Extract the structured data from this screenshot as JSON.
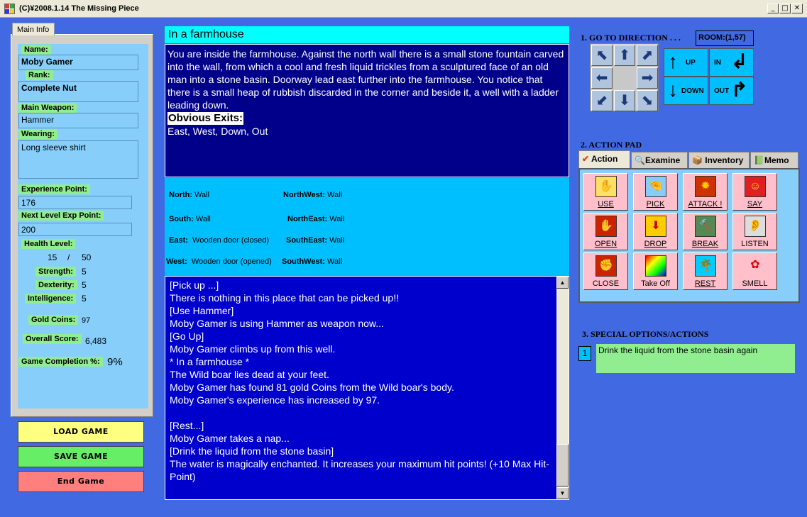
{
  "window": {
    "title": "(C)¥2008.1.14 The Missing Piece",
    "min": "_",
    "max": "□",
    "close": "✕"
  },
  "left": {
    "tab_label": "Main Info",
    "name_label": "Name:",
    "name": "Moby Gamer",
    "rank_label": "Rank:",
    "rank": "Complete Nut",
    "weapon_label": "Main Weapon:",
    "weapon": "Hammer",
    "wearing_label": "Wearing:",
    "wearing": "Long sleeve shirt",
    "exp_label": "Experience Point:",
    "exp": "176",
    "next_label": "Next Level Exp Point:",
    "next": "200",
    "health_label": "Health Level:",
    "health_cur": "15",
    "health_sep": "/",
    "health_max": "50",
    "strength_label": "Strength:",
    "strength": "5",
    "dexterity_label": "Dexterity:",
    "dexterity": "5",
    "intelligence_label": "Intelligence:",
    "intelligence": "5",
    "gold_label": "Gold Coins:",
    "gold": "97",
    "score_label": "Overall Score:",
    "score": "6,483",
    "completion_label": "Game Completion %:",
    "completion": "9%",
    "load_button": "LOAD GAME",
    "save_button": "SAVE GAME",
    "end_button": "End Game"
  },
  "room": {
    "title": "In a farmhouse",
    "description": "You are inside the farmhouse.  Against the north wall there is a small stone fountain carved into the wall, from which a cool and fresh liquid trickles from a sculptured face of an old man into a stone basin. Doorway lead east further into the farmhouse. You notice that there is a small heap of rubbish discarded in the corner and beside it, a well with a ladder leading down.",
    "exits_heading": "Obvious Exits:",
    "exits": "East, West, Down, Out"
  },
  "directions": {
    "north_label": "North:",
    "north": "Wall",
    "south_label": "South:",
    "south": "Wall",
    "east_label": "East:",
    "east": "Wooden door (closed)",
    "west_label": "West:",
    "west": "Wooden door (opened)",
    "northwest_label": "NorthWest:",
    "northwest": "Wall",
    "northeast_label": "NorthEast:",
    "northeast": "Wall",
    "southeast_label": "SouthEast:",
    "southeast": "Wall",
    "southwest_label": "SouthWest:",
    "southwest": "Wall"
  },
  "log": "[Pick up ...]\nThere is nothing in this place that can be picked up!!\n[Use Hammer]\nMoby Gamer is using Hammer as weapon now...\n[Go Up]\nMoby Gamer climbs up from this well.\n* In a farmhouse *\nThe Wild boar lies dead at your feet.\nMoby Gamer has found 81 gold Coins from the Wild boar's body.\nMoby Gamer's experience has increased by 97.\n\n[Rest...]\nMoby Gamer takes a nap...\n[Drink the liquid from the stone basin]\nThe water is magically enchanted. It increases your maximum hit points! (+10 Max Hit-Point)",
  "right": {
    "goto_heading": "1. GO TO DIRECTION . . .",
    "room_coords": "ROOM:(1,57)",
    "up": "UP",
    "down": "DOWN",
    "in": "IN",
    "out": "OUT",
    "action_heading": "2. ACTION PAD",
    "tabs": {
      "action": "Action",
      "examine": "Examine",
      "inventory": "Inventory",
      "memo": "Memo"
    },
    "actions": {
      "use": "USE",
      "pick": "PICK",
      "attack": "ATTACK !",
      "say": "SAY",
      "open": "OPEN",
      "drop": "DROP",
      "break": "BREAK",
      "listen": "LISTEN",
      "close": "CLOSE",
      "takeoff": "Take Off",
      "rest": "REST",
      "smell": "SMELL"
    },
    "special_heading": "3. SPECIAL OPTIONS/ACTIONS",
    "special_num": "1",
    "special_text": "Drink the liquid from the stone basin again"
  }
}
